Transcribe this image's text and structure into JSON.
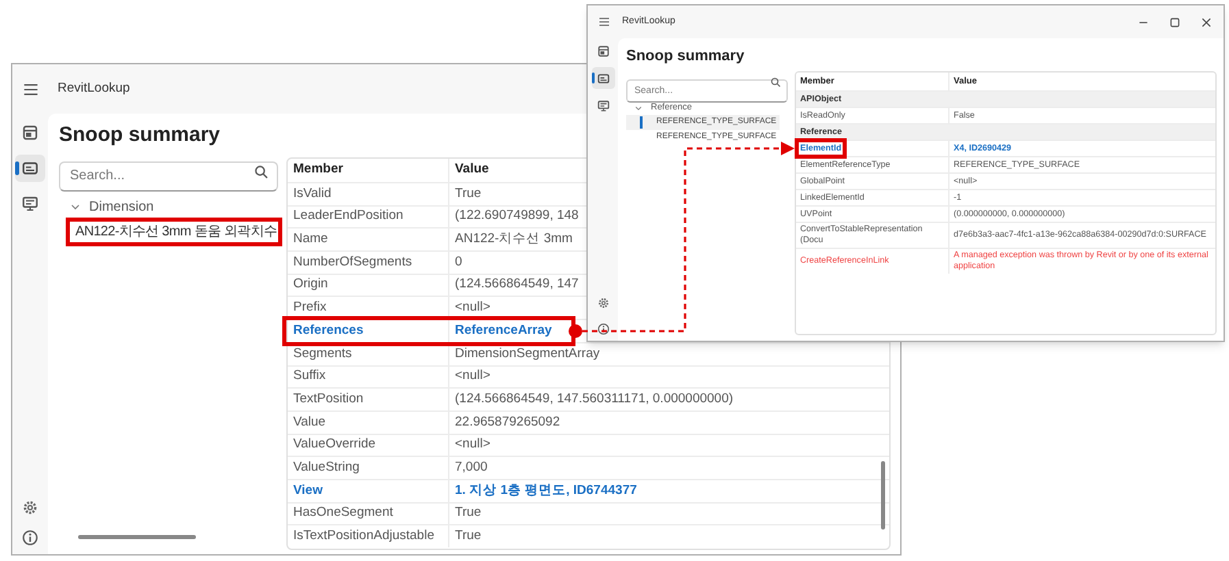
{
  "windows": [
    {
      "title": "RevitLookup",
      "heading": "Snoop summary",
      "search": {
        "placeholder": "Search..."
      },
      "nav": [
        {
          "selected": false
        },
        {
          "selected": true
        },
        {
          "selected": false
        }
      ],
      "tree": [
        {
          "label": "Dimension",
          "expanded": true,
          "children": [
            {
              "label": "AN122-치수선 3mm 돋움 외곽치수",
              "selected": false,
              "highlighted": true
            }
          ]
        }
      ],
      "table": {
        "columns": [
          "Member",
          "Value"
        ],
        "rows": [
          {
            "kind": "property",
            "member": "IsValid",
            "value": "True"
          },
          {
            "kind": "property",
            "member": "LeaderEndPosition",
            "value": "(122.690749899, 148"
          },
          {
            "kind": "property",
            "member": "Name",
            "value": "AN122-치수선 3mm"
          },
          {
            "kind": "property",
            "member": "NumberOfSegments",
            "value": "0"
          },
          {
            "kind": "property",
            "member": "Origin",
            "value": "(124.566864549, 147"
          },
          {
            "kind": "property",
            "member": "Prefix",
            "value": "<null>"
          },
          {
            "kind": "link",
            "member": "References",
            "value": "ReferenceArray",
            "highlighted": true
          },
          {
            "kind": "property",
            "member": "Segments",
            "value": "DimensionSegmentArray"
          },
          {
            "kind": "property",
            "member": "Suffix",
            "value": "<null>"
          },
          {
            "kind": "property",
            "member": "TextPosition",
            "value": "(124.566864549, 147.560311171, 0.000000000)"
          },
          {
            "kind": "property",
            "member": "Value",
            "value": "22.965879265092"
          },
          {
            "kind": "property",
            "member": "ValueOverride",
            "value": "<null>"
          },
          {
            "kind": "property",
            "member": "ValueString",
            "value": "7,000"
          },
          {
            "kind": "link",
            "member": "View",
            "value": "1. 지상 1층 평면도, ID6744377"
          },
          {
            "kind": "property",
            "member": "HasOneSegment",
            "value": "True"
          },
          {
            "kind": "property",
            "member": "IsTextPositionAdjustable",
            "value": "True"
          }
        ]
      }
    },
    {
      "title": "RevitLookup",
      "heading": "Snoop summary",
      "search": {
        "placeholder": "Search..."
      },
      "nav": [
        {
          "selected": false
        },
        {
          "selected": true
        },
        {
          "selected": false
        }
      ],
      "tree": [
        {
          "label": "Reference",
          "expanded": true,
          "children": [
            {
              "label": "REFERENCE_TYPE_SURFACE",
              "selected": true
            },
            {
              "label": "REFERENCE_TYPE_SURFACE",
              "selected": false
            }
          ]
        }
      ],
      "table": {
        "columns": [
          "Member",
          "Value"
        ],
        "rows": [
          {
            "kind": "group",
            "member": "APIObject"
          },
          {
            "kind": "property",
            "member": "IsReadOnly",
            "value": "False"
          },
          {
            "kind": "group",
            "member": "Reference"
          },
          {
            "kind": "link",
            "member": "ElementId",
            "value": "X4, ID2690429",
            "highlighted": true
          },
          {
            "kind": "property",
            "member": "ElementReferenceType",
            "value": "REFERENCE_TYPE_SURFACE"
          },
          {
            "kind": "property",
            "member": "GlobalPoint",
            "value": "<null>"
          },
          {
            "kind": "property",
            "member": "LinkedElementId",
            "value": "-1"
          },
          {
            "kind": "property",
            "member": "UVPoint",
            "value": "(0.000000000, 0.000000000)"
          },
          {
            "kind": "property",
            "member": "ConvertToStableRepresentation (Docu",
            "value": "d7e6b3a3-aac7-4fc1-a13e-962ca88a6384-00290d7d:0:SURFACE"
          },
          {
            "kind": "error",
            "member": "CreateReferenceInLink",
            "value": "A managed exception was thrown by Revit or by one of its external application"
          }
        ]
      }
    }
  ]
}
